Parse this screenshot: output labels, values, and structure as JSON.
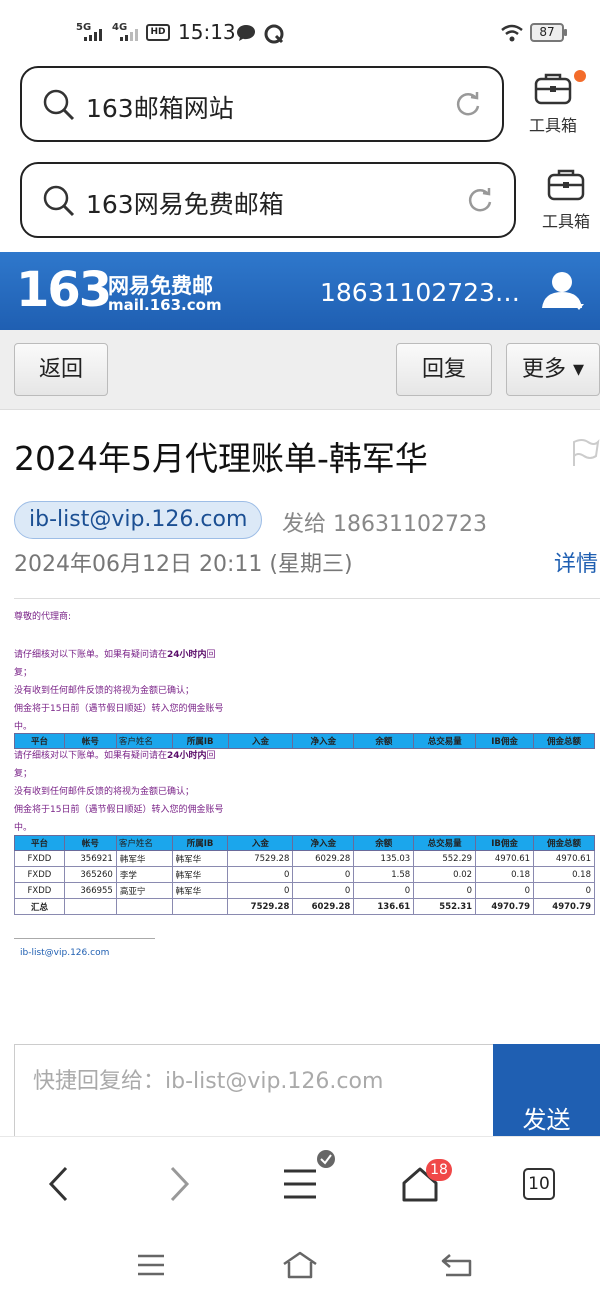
{
  "status": {
    "sim1": "5G",
    "sim2": "4G",
    "hd": "HD",
    "time": "15:13",
    "battery": "87"
  },
  "search_bars": [
    {
      "query": "163邮箱网站",
      "toolbox_label": "工具箱"
    },
    {
      "query": "163网易免费邮箱",
      "toolbox_label": "工具箱"
    }
  ],
  "mail_header": {
    "logo_number": "163",
    "logo_cn": "网易免费邮",
    "logo_en": "mail.163.com",
    "account": "18631102723…"
  },
  "actions": {
    "back": "返回",
    "reply": "回复",
    "more": "更多 ▾"
  },
  "mail": {
    "subject": "2024年5月代理账单-韩军华",
    "sender": "ib-list@vip.126.com",
    "sent_to": "发给 18631102723",
    "date": "2024年06月12日 20:11 (星期三)",
    "detail_link": "详情"
  },
  "body": {
    "greeting": "尊敬的代理商:",
    "para1_a": "请仔细核对以下账单。如果有疑问请在",
    "para1_bold": "24小时内",
    "para1_b": "回",
    "para1_c": "复；",
    "para2": "没有收到任何邮件反馈的将视为金额已确认；",
    "para3": "佣金将于15日前（遇节假日顺延）转入您的佣金账号",
    "para3_end": "中。",
    "headers": [
      "平台",
      "帐号",
      "客户姓名",
      "所属IB",
      "入金",
      "净入金",
      "余额",
      "总交易量",
      "IB佣金",
      "佣金总额"
    ],
    "rows": [
      [
        "FXDD",
        "356921",
        "韩军华",
        "韩军华",
        "7529.28",
        "6029.28",
        "135.03",
        "552.29",
        "4970.61",
        "4970.61"
      ],
      [
        "FXDD",
        "365260",
        "李学",
        "韩军华",
        "0",
        "0",
        "1.58",
        "0.02",
        "0.18",
        "0.18"
      ],
      [
        "FXDD",
        "366955",
        "高亚宁",
        "韩军华",
        "0",
        "0",
        "0",
        "0",
        "0",
        "0"
      ]
    ],
    "total": [
      "汇总",
      "",
      "",
      "",
      "7529.28",
      "6029.28",
      "136.61",
      "552.31",
      "4970.79",
      "4970.79"
    ],
    "signature": "ib-list@vip.126.com"
  },
  "quick_reply": {
    "placeholder": "快捷回复给：ib-list@vip.126.com",
    "send": "发送"
  },
  "browser_nav": {
    "home_badge": "18",
    "tabs": "10"
  },
  "colors": {
    "brand_blue": "#1f5fb2",
    "table_header": "#1ba6ec",
    "body_text": "#7a2388",
    "badge_red": "#f04848",
    "notify_dot": "#f36c2b"
  }
}
